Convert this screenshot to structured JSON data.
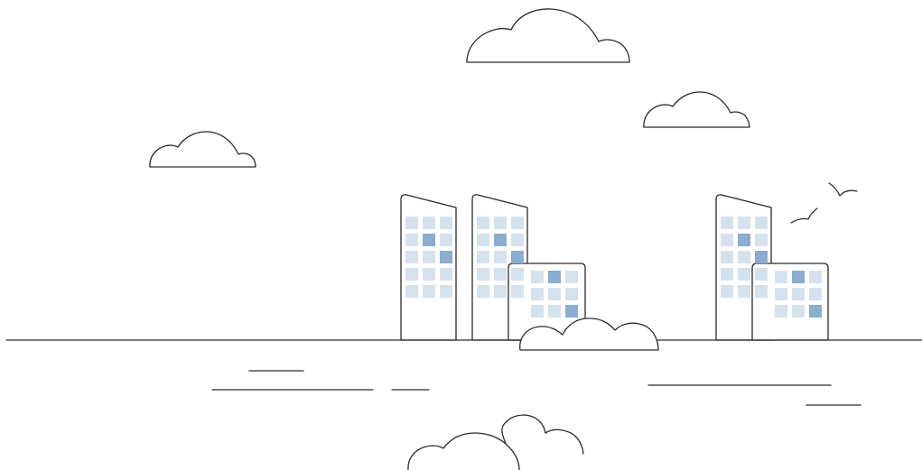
{
  "colors": {
    "background": "#ffffff",
    "stroke": "#2b2b2b",
    "window_light": "#d6e1ee",
    "window_dark": "#8aadd0"
  },
  "icons": [
    "cloud-icon",
    "building-icon",
    "bird-icon",
    "bush-icon"
  ]
}
